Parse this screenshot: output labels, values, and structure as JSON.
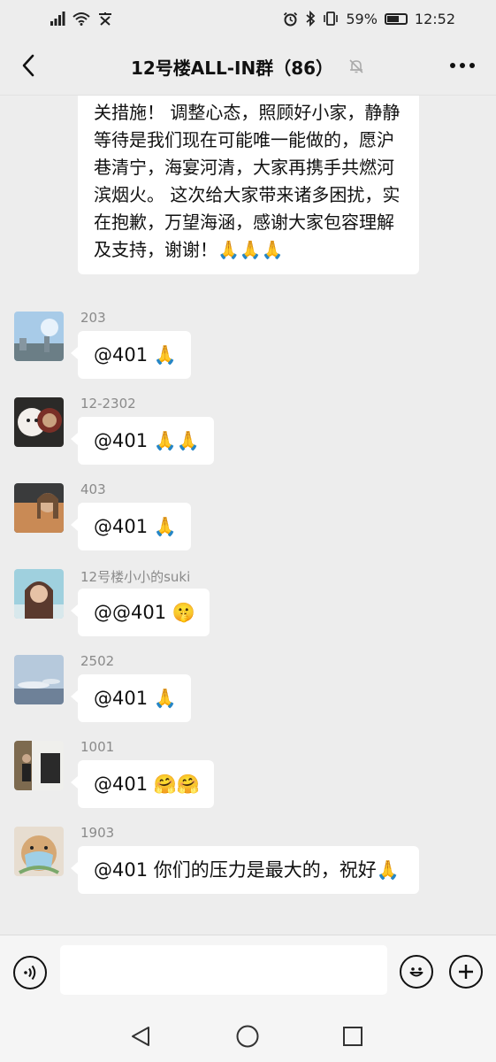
{
  "status_bar": {
    "battery": "59%",
    "time": "12:52"
  },
  "header": {
    "title": "12号楼ALL-IN群（86）"
  },
  "first_message": {
    "text": "关措施！ 调整心态，照顾好小家，静静等待是我们现在可能唯一能做的，愿沪巷清宁，海宴河清，大家再携手共燃河滨烟火。 这次给大家带来诸多困扰，实在抱歉，万望海涵，感谢大家包容理解及支持，谢谢！🙏🙏🙏"
  },
  "messages": [
    {
      "sender": "203",
      "text": "@401 🙏",
      "avatar_colors": [
        "#9ec6e8",
        "#5d7a8a"
      ]
    },
    {
      "sender": "12-2302",
      "text": "@401 🙏🙏",
      "avatar_colors": [
        "#f1ece8",
        "#7a2f27"
      ]
    },
    {
      "sender": "403",
      "text": "@401 🙏",
      "avatar_colors": [
        "#c98a55",
        "#3c3d3e"
      ]
    },
    {
      "sender": "12号楼小小的suki",
      "text": "@@401 🤫",
      "avatar_colors": [
        "#8ec7d8",
        "#5a3a2e"
      ]
    },
    {
      "sender": "2502",
      "text": "@401 🙏",
      "avatar_colors": [
        "#aac0d6",
        "#5d6f86"
      ]
    },
    {
      "sender": "1001",
      "text": "@401 🤗🤗",
      "avatar_colors": [
        "#f2f2ef",
        "#242424"
      ]
    },
    {
      "sender": "1903",
      "text": "@401 你们的压力是最大的，祝好🙏",
      "avatar_colors": [
        "#d9b58a",
        "#9cc9e0"
      ]
    }
  ],
  "input": {
    "placeholder": ""
  },
  "icons": {
    "back": "chevron-left-icon",
    "mute": "bell-muted-icon",
    "more": "more-dots-icon",
    "voice": "voice-icon",
    "emoji": "smile-icon",
    "add": "plus-icon",
    "nav_back": "triangle-back-icon",
    "nav_home": "circle-home-icon",
    "nav_recent": "square-recent-icon"
  }
}
